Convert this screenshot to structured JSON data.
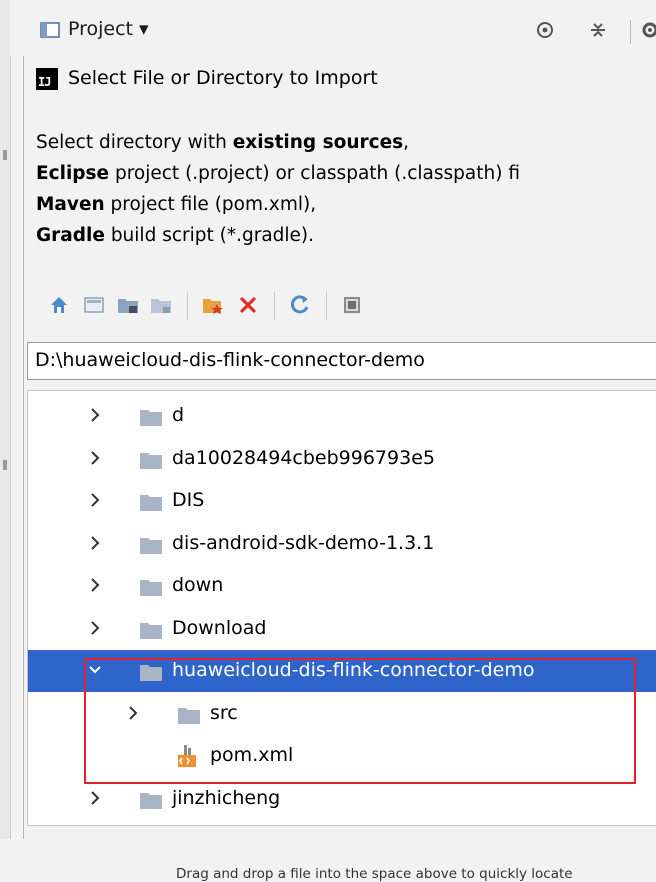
{
  "ide": {
    "panel_title": "Project ▾"
  },
  "dialog": {
    "logo_text": "IJ",
    "title": "Select File or Directory to Import",
    "description": [
      {
        "prefix": "Select directory with ",
        "bold": "existing sources",
        "suffix": ","
      },
      {
        "prefix": "",
        "bold": "Eclipse",
        "suffix": " project (.project) or classpath (.classpath) fi"
      },
      {
        "prefix": "",
        "bold": "Maven",
        "suffix": " project file (pom.xml),"
      },
      {
        "prefix": "",
        "bold": "Gradle",
        "suffix": " build script (*.gradle)."
      }
    ],
    "toolbar": [
      {
        "name": "home-icon"
      },
      {
        "name": "desktop-icon"
      },
      {
        "name": "project-folder-icon"
      },
      {
        "name": "module-folder-icon"
      },
      {
        "name": "new-folder-icon"
      },
      {
        "name": "delete-icon"
      },
      {
        "name": "refresh-icon"
      },
      {
        "name": "show-hidden-icon"
      }
    ],
    "path_value": "D:\\huaweicloud-dis-flink-connector-demo",
    "tree": [
      {
        "label": "d",
        "level": 0,
        "expanded": false,
        "type": "folder",
        "selected": false
      },
      {
        "label": "da10028494cbeb996793e5",
        "level": 0,
        "expanded": false,
        "type": "folder",
        "selected": false
      },
      {
        "label": "DIS",
        "level": 0,
        "expanded": false,
        "type": "folder",
        "selected": false
      },
      {
        "label": "dis-android-sdk-demo-1.3.1",
        "level": 0,
        "expanded": false,
        "type": "folder",
        "selected": false
      },
      {
        "label": "down",
        "level": 0,
        "expanded": false,
        "type": "folder",
        "selected": false
      },
      {
        "label": "Download",
        "level": 0,
        "expanded": false,
        "type": "folder",
        "selected": false
      },
      {
        "label": "huaweicloud-dis-flink-connector-demo",
        "level": 0,
        "expanded": true,
        "type": "folder",
        "selected": true
      },
      {
        "label": "src",
        "level": 1,
        "expanded": false,
        "type": "folder",
        "selected": false
      },
      {
        "label": "pom.xml",
        "level": 1,
        "expanded": null,
        "type": "maven-file",
        "selected": false
      },
      {
        "label": "jinzhicheng",
        "level": 0,
        "expanded": false,
        "type": "folder",
        "selected": false
      }
    ],
    "hint": "Drag and drop a file into the space above to quickly locate"
  },
  "colors": {
    "selection": "#2f65ca",
    "folder": "#a9b4c4",
    "highlight_box": "#e2232c"
  }
}
